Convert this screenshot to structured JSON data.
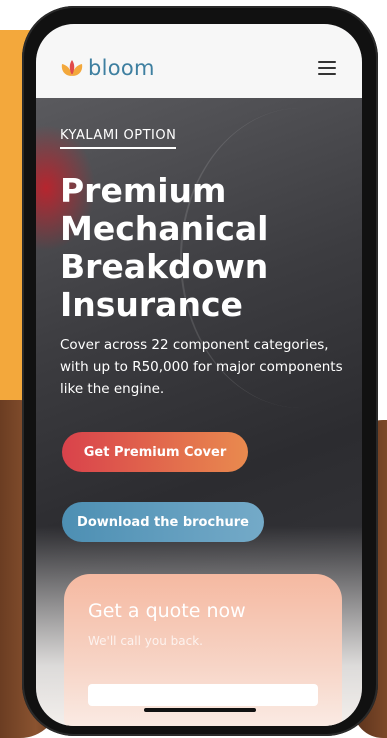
{
  "brand": {
    "name": "bloom",
    "accent": "#3e7fa0",
    "icon_colors": [
      "#f3a83c",
      "#e04a4a"
    ]
  },
  "header": {
    "menu_icon": "hamburger-menu-icon"
  },
  "hero": {
    "eyebrow": "KYALAMI OPTION",
    "headline_lines": [
      "Premium",
      "Mechanical",
      "Breakdown",
      "Insurance"
    ],
    "subtext": "Cover across 22 component categories, with up to R50,000 for major components like the engine."
  },
  "buttons": {
    "premium_cover": "Get Premium Cover",
    "download_brochure": "Download the brochure"
  },
  "quote": {
    "title": "Get a quote now",
    "subtitle": "We'll call you back."
  },
  "colors": {
    "primary_gradient": [
      "#d9424b",
      "#e98a4e"
    ],
    "secondary_gradient": [
      "#4d8fb3",
      "#74aac8"
    ]
  }
}
